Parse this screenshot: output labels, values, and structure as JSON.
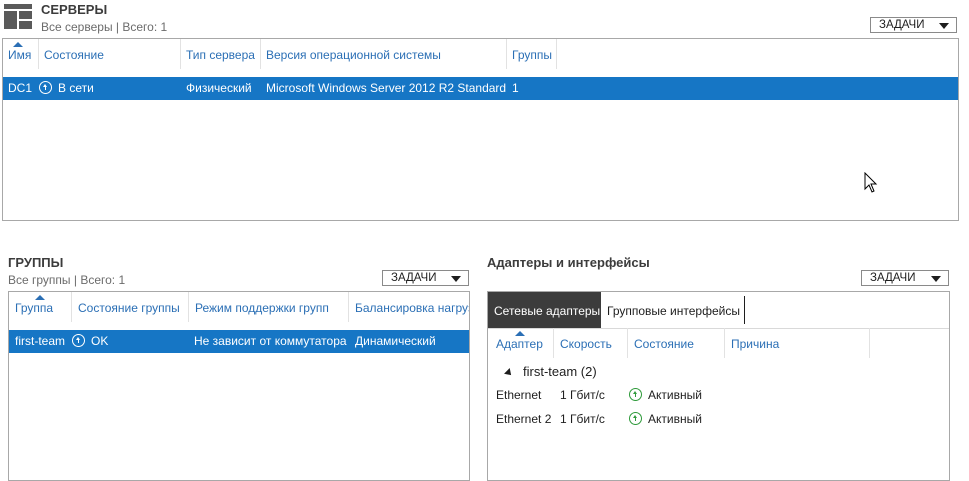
{
  "servers": {
    "title": "СЕРВЕРЫ",
    "subtitle": "Все серверы | Всего: 1",
    "tasks_label": "ЗАДАЧИ",
    "columns": [
      "Имя",
      "Состояние",
      "Тип сервера",
      "Версия операционной системы",
      "Группы"
    ],
    "rows": [
      {
        "name": "DC1",
        "state": "В сети",
        "type": "Физический",
        "os": "Microsoft Windows Server 2012 R2 Standard",
        "groups": "1"
      }
    ]
  },
  "groups": {
    "title": "ГРУППЫ",
    "subtitle": "Все группы | Всего: 1",
    "tasks_label": "ЗАДАЧИ",
    "columns": [
      "Группа",
      "Состояние группы",
      "Режим поддержки групп",
      "Балансировка нагрузки"
    ],
    "rows": [
      {
        "group": "first-team",
        "state": "OK",
        "mode": "Не зависит от коммутатора",
        "balancing": "Динамический"
      }
    ]
  },
  "adapters": {
    "title": "Адаптеры и интерфейсы",
    "tasks_label": "ЗАДАЧИ",
    "tabs": [
      "Сетевые адаптеры",
      "Групповые интерфейсы"
    ],
    "active_tab": "Сетевые адаптеры",
    "columns": [
      "Адаптер",
      "Скорость",
      "Состояние",
      "Причина"
    ],
    "group_header": "first-team (2)",
    "rows": [
      {
        "adapter": "Ethernet",
        "speed": "1 Гбит/с",
        "state": "Активный"
      },
      {
        "adapter": "Ethernet 2",
        "speed": "1 Гбит/с",
        "state": "Активный"
      }
    ]
  },
  "colors": {
    "selection": "#1676c5",
    "header_text": "#2b6fb5",
    "status_green": "#2e9a3a"
  }
}
